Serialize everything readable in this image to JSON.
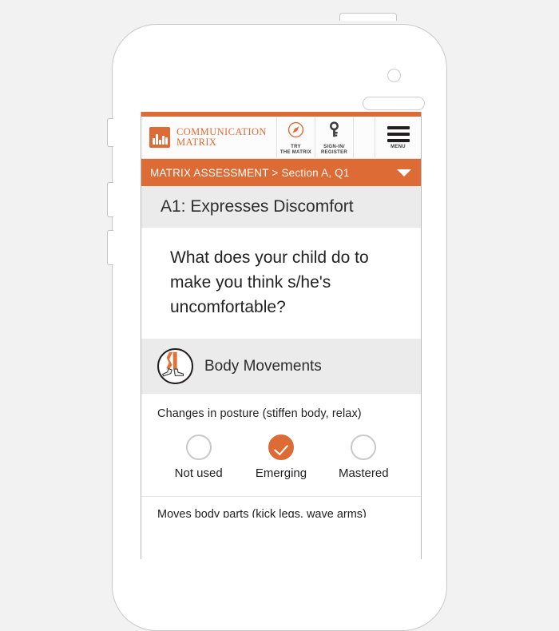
{
  "colors": {
    "accent": "#dd6b35",
    "band": "#ebebeb",
    "text": "#222222",
    "header_bg": "#fcfcfc"
  },
  "header": {
    "brand_line1": "COMMUNICATION",
    "brand_line2": "MATRIX",
    "brand_icon": "bar-chart-logo-icon",
    "actions": [
      {
        "icon": "compass-navigate-icon",
        "label_line1": "TRY",
        "label_line2": "THE MATRIX"
      },
      {
        "icon": "key-icon",
        "label_line1": "SIGN-IN/",
        "label_line2": "REGISTER"
      }
    ],
    "menu": {
      "icon": "hamburger-menu-icon",
      "label": "MENU"
    }
  },
  "breadcrumb": {
    "section": "MATRIX ASSESSMENT",
    "separator": " > ",
    "current": "Section A, Q1",
    "caret_icon": "chevron-down-icon"
  },
  "main": {
    "item_title": "A1: Expresses Discomfort",
    "question": "What does your child do to make you think s/he's uncomfortable?",
    "category": {
      "icon": "walking-legs-icon",
      "title": "Body Movements"
    },
    "behavior": {
      "label": "Changes in posture (stiffen body, relax)",
      "options": [
        {
          "label": "Not used",
          "selected": false
        },
        {
          "label": "Emerging",
          "selected": true
        },
        {
          "label": "Mastered",
          "selected": false
        }
      ]
    },
    "next_behavior_peek": "Moves body parts (kick legs, wave arms)"
  },
  "device": {
    "camera": "front-camera",
    "speaker": "earpiece-speaker",
    "power_button": "power-button",
    "side_buttons": [
      "silent-switch",
      "volume-up-button",
      "volume-down-button"
    ]
  }
}
